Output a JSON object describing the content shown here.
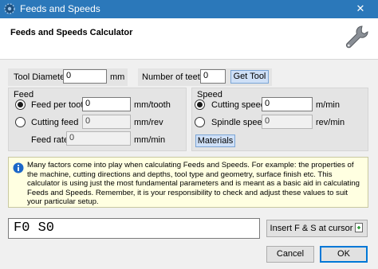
{
  "window": {
    "title": "Feeds and Speeds",
    "close_symbol": "✕",
    "titlebar_color": "#2b78ba"
  },
  "header": {
    "title": "Feeds and Speeds Calculator",
    "icon": "wrench-icon"
  },
  "tool": {
    "diameter_label": "Tool Diameter",
    "diameter_value": "0",
    "diameter_unit": "mm",
    "teeth_label": "Number of teeth",
    "teeth_value": "0",
    "get_tool_label": "Get Tool"
  },
  "feed": {
    "group_title": "Feed",
    "per_tooth_label": "Feed per tooth",
    "per_tooth_value": "0",
    "per_tooth_unit": "mm/tooth",
    "per_tooth_selected": true,
    "cutting_label": "Cutting feed",
    "cutting_value": "0",
    "cutting_unit": "mm/rev",
    "cutting_selected": false,
    "rate_label": "Feed rate",
    "rate_value": "0",
    "rate_unit": "mm/min"
  },
  "speed": {
    "group_title": "Speed",
    "cutting_label": "Cutting speed",
    "cutting_value": "0",
    "cutting_unit": "m/min",
    "cutting_selected": true,
    "spindle_label": "Spindle speed",
    "spindle_value": "0",
    "spindle_unit": "rev/min",
    "spindle_selected": false,
    "materials_label": "Materials"
  },
  "info": {
    "icon": "info-icon",
    "text": "Many factors come into play when calculating Feeds and Speeds. For example: the properties of the machine, cutting directions and depths, tool type and geometry, surface finish etc. This calculator is using just the most fundamental parameters and is meant as a basic aid in calculating Feeds and Speeds. Remember, it is your responsibility to check and adjust these values to suit your particular setup."
  },
  "output": {
    "value": "F0 S0",
    "insert_label": "Insert F & S at cursor"
  },
  "footer": {
    "cancel_label": "Cancel",
    "ok_label": "OK"
  }
}
